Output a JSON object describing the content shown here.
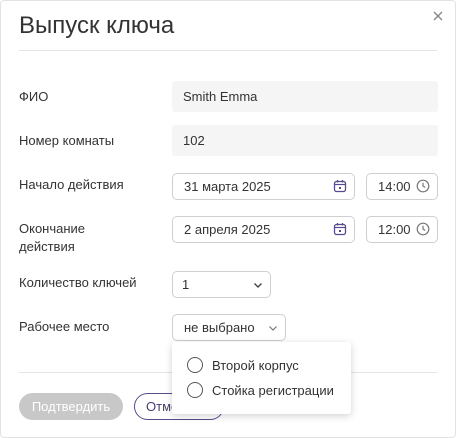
{
  "dialog": {
    "title": "Выпуск ключа"
  },
  "fields": {
    "name_label": "ФИО",
    "name_value": "Smith Emma",
    "room_label": "Номер комнаты",
    "room_value": "102",
    "start_label": "Начало действия",
    "start_date": "31 марта 2025",
    "start_time": "14:00",
    "end_label_line1": "Окончание",
    "end_label_line2": "действия",
    "end_date": "2 апреля 2025",
    "end_time": "12:00",
    "keys_label": "Количество ключей",
    "keys_value": "1",
    "workplace_label": "Рабочее место",
    "workplace_value": "не выбрано"
  },
  "workplace_dropdown": {
    "options": [
      {
        "label": "Второй корпус",
        "selected": false
      },
      {
        "label": "Стойка регистрации",
        "selected": false
      }
    ]
  },
  "buttons": {
    "confirm": "Подтвердить",
    "cancel": "Отмена"
  },
  "colors": {
    "accent": "#5b4a8b",
    "disabled_button": "#c8c8c8",
    "readonly_bg": "#f5f5f5"
  },
  "icons": {
    "close": "close-icon",
    "calendar": "calendar-icon",
    "clock": "clock-icon",
    "chevron": "chevron-down-icon"
  }
}
